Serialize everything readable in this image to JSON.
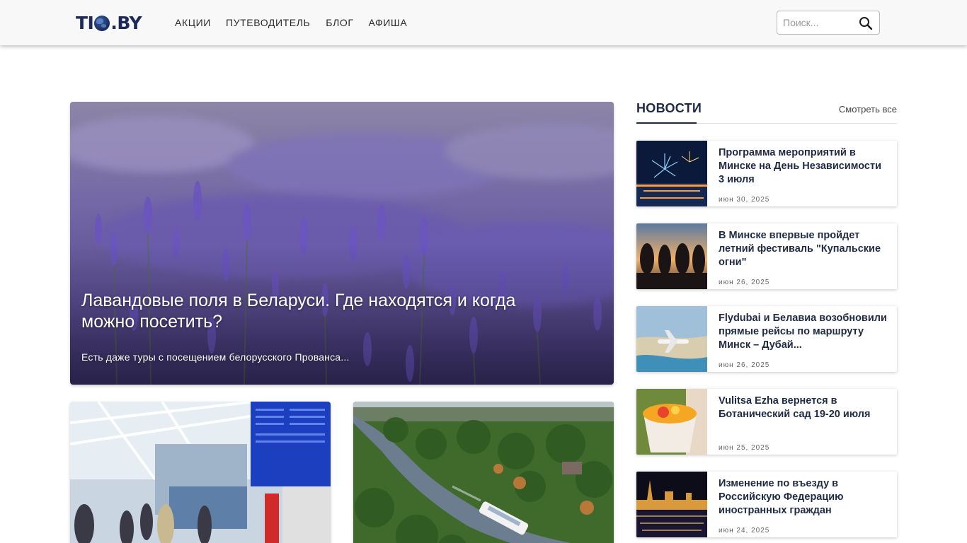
{
  "header": {
    "logo": {
      "part1": "TI",
      "part2": ".BY"
    },
    "nav": [
      {
        "label": "АКЦИИ"
      },
      {
        "label": "ПУТЕВОДИТЕЛЬ"
      },
      {
        "label": "БЛОГ"
      },
      {
        "label": "АФИША"
      }
    ],
    "search": {
      "placeholder": "Поиск...",
      "icon": "search-icon"
    }
  },
  "hero": {
    "title": "Лавандовые поля в Беларуси. Где находятся и когда можно посетить?",
    "subtitle": "Есть даже туры с посещением белорусского Прованса..."
  },
  "news": {
    "heading": "НОВОСТИ",
    "see_all": "Смотреть все",
    "items": [
      {
        "title": "Программа мероприятий в Минске на День Независимости 3 июля",
        "date": "июн 30, 2025"
      },
      {
        "title": "В Минске впервые пройдет летний фестиваль \"Купальские огни\"",
        "date": "июн 26, 2025"
      },
      {
        "title": "Flydubai и Белавиа возобновили прямые рейсы по маршруту Минск – Дубай...",
        "date": "июн 26, 2025"
      },
      {
        "title": "Vulitsa Ezha вернется в Ботанический сад 19-20 июля",
        "date": "июн 25, 2025"
      },
      {
        "title": "Изменение по въезду в Российскую Федерацию иностранных граждан",
        "date": "июн 24, 2025"
      }
    ]
  },
  "colors": {
    "brand": "#1b2a5a",
    "text": "#1f2a44",
    "lavender": "#6f5fb0"
  }
}
